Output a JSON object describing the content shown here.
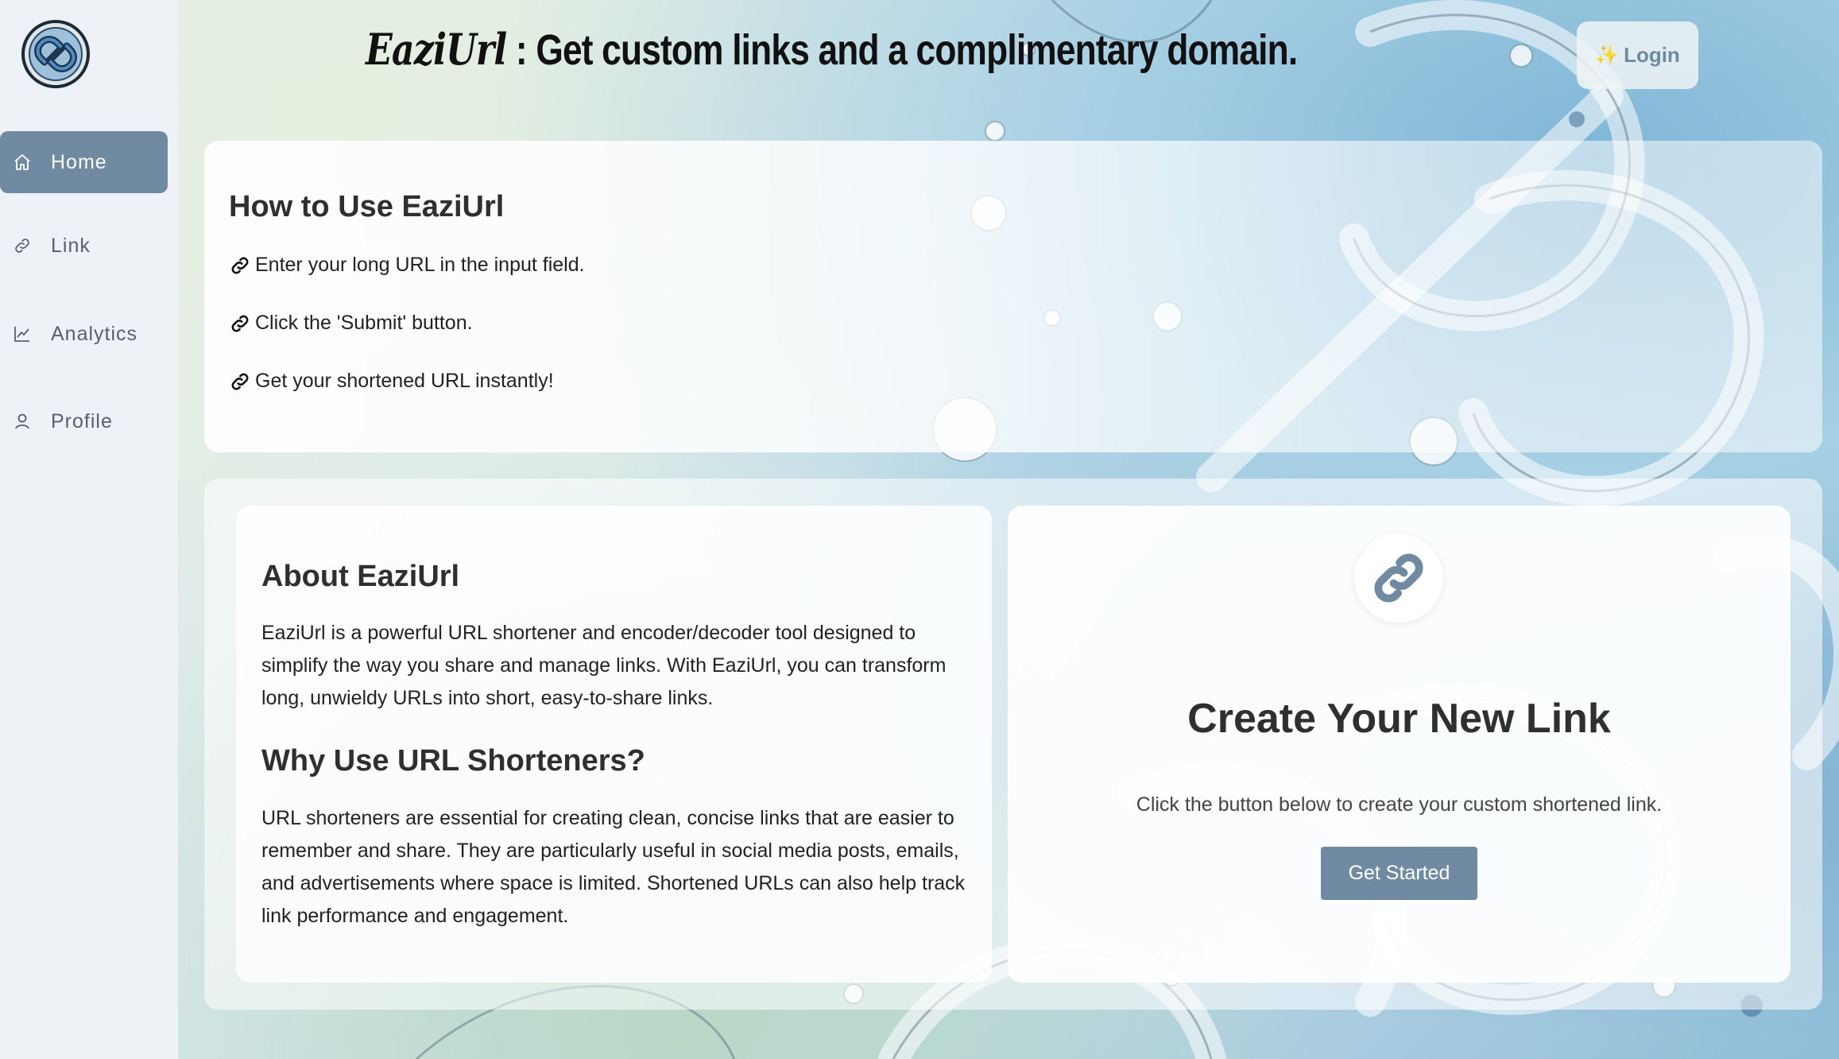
{
  "app": {
    "brand": "EaziUrl",
    "headline": " : Get custom links and a complimentary domain.",
    "accent_color": "#6f8aa1"
  },
  "sidebar": {
    "items": [
      {
        "label": "Home",
        "icon": "home-icon",
        "active": true
      },
      {
        "label": "Link",
        "icon": "link-icon",
        "active": false
      },
      {
        "label": "Analytics",
        "icon": "chart-line-icon",
        "active": false
      },
      {
        "label": "Profile",
        "icon": "user-icon",
        "active": false
      }
    ]
  },
  "header": {
    "login_label": "Login",
    "login_icon": "sparkle-icon"
  },
  "howto": {
    "title": "How to Use EaziUrl",
    "steps": [
      "Enter your long URL in the input field.",
      "Click the 'Submit' button.",
      "Get your shortened URL instantly!"
    ]
  },
  "about": {
    "title": "About EaziUrl",
    "text": "EaziUrl is a powerful URL shortener and encoder/decoder tool designed to simplify the way you share and manage links. With EaziUrl, you can transform long, unwieldy URLs into short, easy-to-share links.",
    "why_title": "Why Use URL Shorteners?",
    "why_text": "URL shorteners are essential for creating clean, concise links that are easier to remember and share. They are particularly useful in social media posts, emails, and advertisements where space is limited. Shortened URLs can also help track link performance and engagement."
  },
  "create": {
    "title": "Create Your New Link",
    "subtitle": "Click the button below to create your custom shortened link.",
    "button_label": "Get Started"
  }
}
